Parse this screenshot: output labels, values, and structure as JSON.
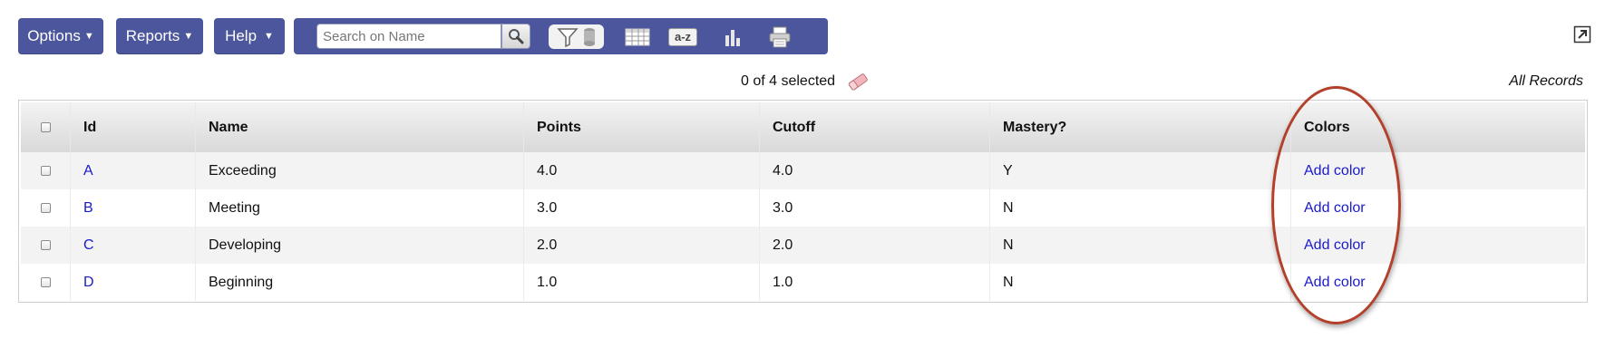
{
  "menu": {
    "options_label": "Options",
    "reports_label": "Reports",
    "help_label": "Help"
  },
  "toolbar": {
    "search_placeholder": "Search on Name",
    "search_value": "",
    "icons": [
      "search-icon",
      "filter-icon",
      "grid-icon",
      "sort-az-icon",
      "bar-chart-icon",
      "print-icon"
    ],
    "sort_label": "a-z"
  },
  "status": {
    "selected_text": "0 of 4 selected",
    "scope_label": "All Records"
  },
  "table": {
    "columns": [
      "Id",
      "Name",
      "Points",
      "Cutoff",
      "Mastery?",
      "Colors"
    ],
    "rows": [
      {
        "id": "A",
        "name": "Exceeding",
        "points": "4.0",
        "cutoff": "4.0",
        "mastery": "Y",
        "colors": "Add color"
      },
      {
        "id": "B",
        "name": "Meeting",
        "points": "3.0",
        "cutoff": "3.0",
        "mastery": "N",
        "colors": "Add color"
      },
      {
        "id": "C",
        "name": "Developing",
        "points": "2.0",
        "cutoff": "2.0",
        "mastery": "N",
        "colors": "Add color"
      },
      {
        "id": "D",
        "name": "Beginning",
        "points": "1.0",
        "cutoff": "1.0",
        "mastery": "N",
        "colors": "Add color"
      }
    ]
  },
  "colors": {
    "toolbar_bg": "#4b569c",
    "link": "#1a1acc",
    "annotation": "#b3402a"
  }
}
